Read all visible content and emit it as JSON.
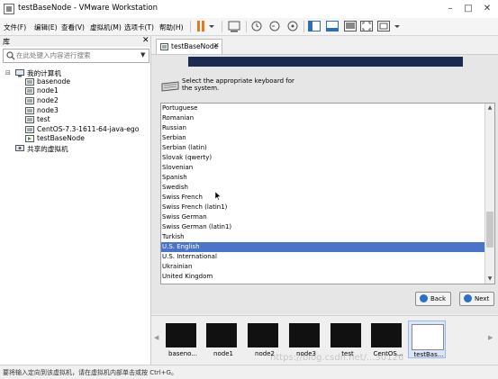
{
  "window": {
    "title": "testBaseNode - VMware Workstation"
  },
  "menu": {
    "items": [
      "文件(F)",
      "编辑(E)",
      "查看(V)",
      "虚拟机(M)",
      "选项卡(T)",
      "帮助(H)"
    ]
  },
  "library": {
    "title": "库",
    "search_placeholder": "在此处键入内容进行搜索",
    "tree": {
      "root": "我的计算机",
      "vms": [
        "basenode",
        "node1",
        "node2",
        "node3",
        "test",
        "CentOS-7.3-1611-64-java-ego",
        "testBaseNode"
      ],
      "shared": "共享的虚拟机"
    }
  },
  "tab": {
    "label": "testBaseNode"
  },
  "installer": {
    "prompt_line1": "Select the appropriate keyboard for",
    "prompt_line2": "the system.",
    "selected": "U.S. English",
    "layouts": [
      "Portuguese",
      "Romanian",
      "Russian",
      "Serbian",
      "Serbian (latin)",
      "Slovak (qwerty)",
      "Slovenian",
      "Spanish",
      "Swedish",
      "Swiss French",
      "Swiss French (latin1)",
      "Swiss German",
      "Swiss German (latin1)",
      "Turkish",
      "U.S. English",
      "U.S. International",
      "Ukrainian",
      "United Kingdom"
    ],
    "back_label": "Back",
    "next_label": "Next"
  },
  "thumbnails": [
    "baseno...",
    "node1",
    "node2",
    "node3",
    "test",
    "CentOS...",
    "testBas..."
  ],
  "status": {
    "text": "要将输入定向到该虚拟机，请在虚拟机内部单击或按 Ctrl+G。"
  },
  "watermark": "https://blog.csdn.net/...30126",
  "colors": {
    "selection": "#4a74c9",
    "progress": "#1c2a52",
    "accent": "#2b6fc7"
  }
}
